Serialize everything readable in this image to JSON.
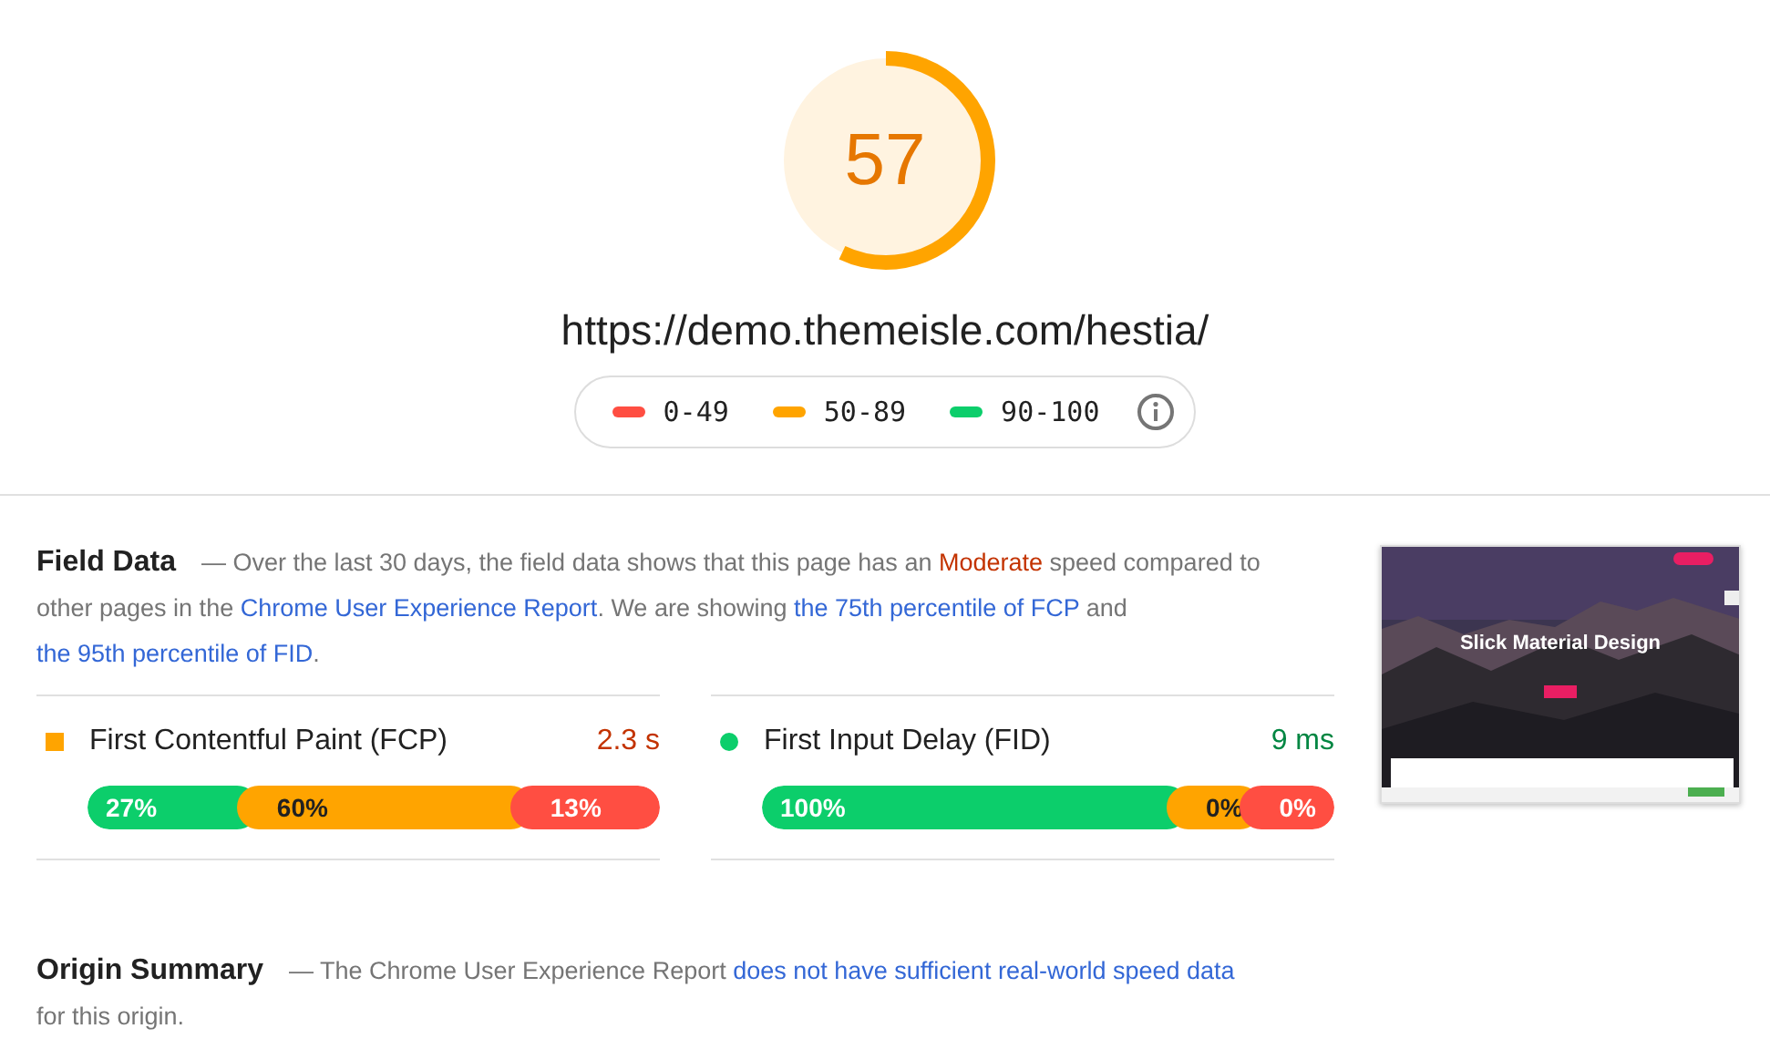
{
  "score": {
    "value": "57",
    "kind": "average"
  },
  "url": "https://demo.themeisle.com/hestia/",
  "legend": [
    {
      "range": "0-49",
      "color": "#ff4e42"
    },
    {
      "range": "50-89",
      "color": "#ffa400"
    },
    {
      "range": "90-100",
      "color": "#0cce6b"
    }
  ],
  "field_data": {
    "title": "Field Data",
    "description": [
      {
        "kind": "plain",
        "text": "— Over the last 30 days, the field data shows that this page has an "
      },
      {
        "kind": "rating",
        "text": "Moderate"
      },
      {
        "kind": "plain",
        "text": " speed compared to other pages in the "
      },
      {
        "kind": "link",
        "text": "Chrome User Experience Report"
      },
      {
        "kind": "plain",
        "text": ". We are showing "
      },
      {
        "kind": "link",
        "text": "the 75th percentile of FCP"
      },
      {
        "kind": "plain",
        "text": " and "
      },
      {
        "kind": "link",
        "text": "the 95th percentile of FID"
      },
      {
        "kind": "plain",
        "text": "."
      }
    ],
    "metrics": [
      {
        "name": "First Contentful Paint (FCP)",
        "value": "2.3 s",
        "kind": "average",
        "segments": [
          {
            "label": "27%",
            "color": "#0cce6b"
          },
          {
            "label": "60%",
            "color": "#ffa400"
          },
          {
            "label": "13%",
            "color": "#ff4e42"
          }
        ]
      },
      {
        "name": "First Input Delay (FID)",
        "value": "9 ms",
        "kind": "fast",
        "segments": [
          {
            "label": "100%",
            "color": "#0cce6b"
          },
          {
            "label": "0%",
            "color": "#ffa400"
          },
          {
            "label": "0%",
            "color": "#ff4e42"
          }
        ]
      }
    ],
    "screenshot": {
      "kind": "picture",
      "headline": "Slick Material Design"
    }
  },
  "origin_summary": {
    "title": "Origin Summary",
    "description": [
      {
        "kind": "plain",
        "text": "— The Chrome User Experience Report "
      },
      {
        "kind": "link",
        "text": "does not have sufficient real-world speed data"
      },
      {
        "kind": "plain",
        "text": " for this origin."
      }
    ]
  }
}
